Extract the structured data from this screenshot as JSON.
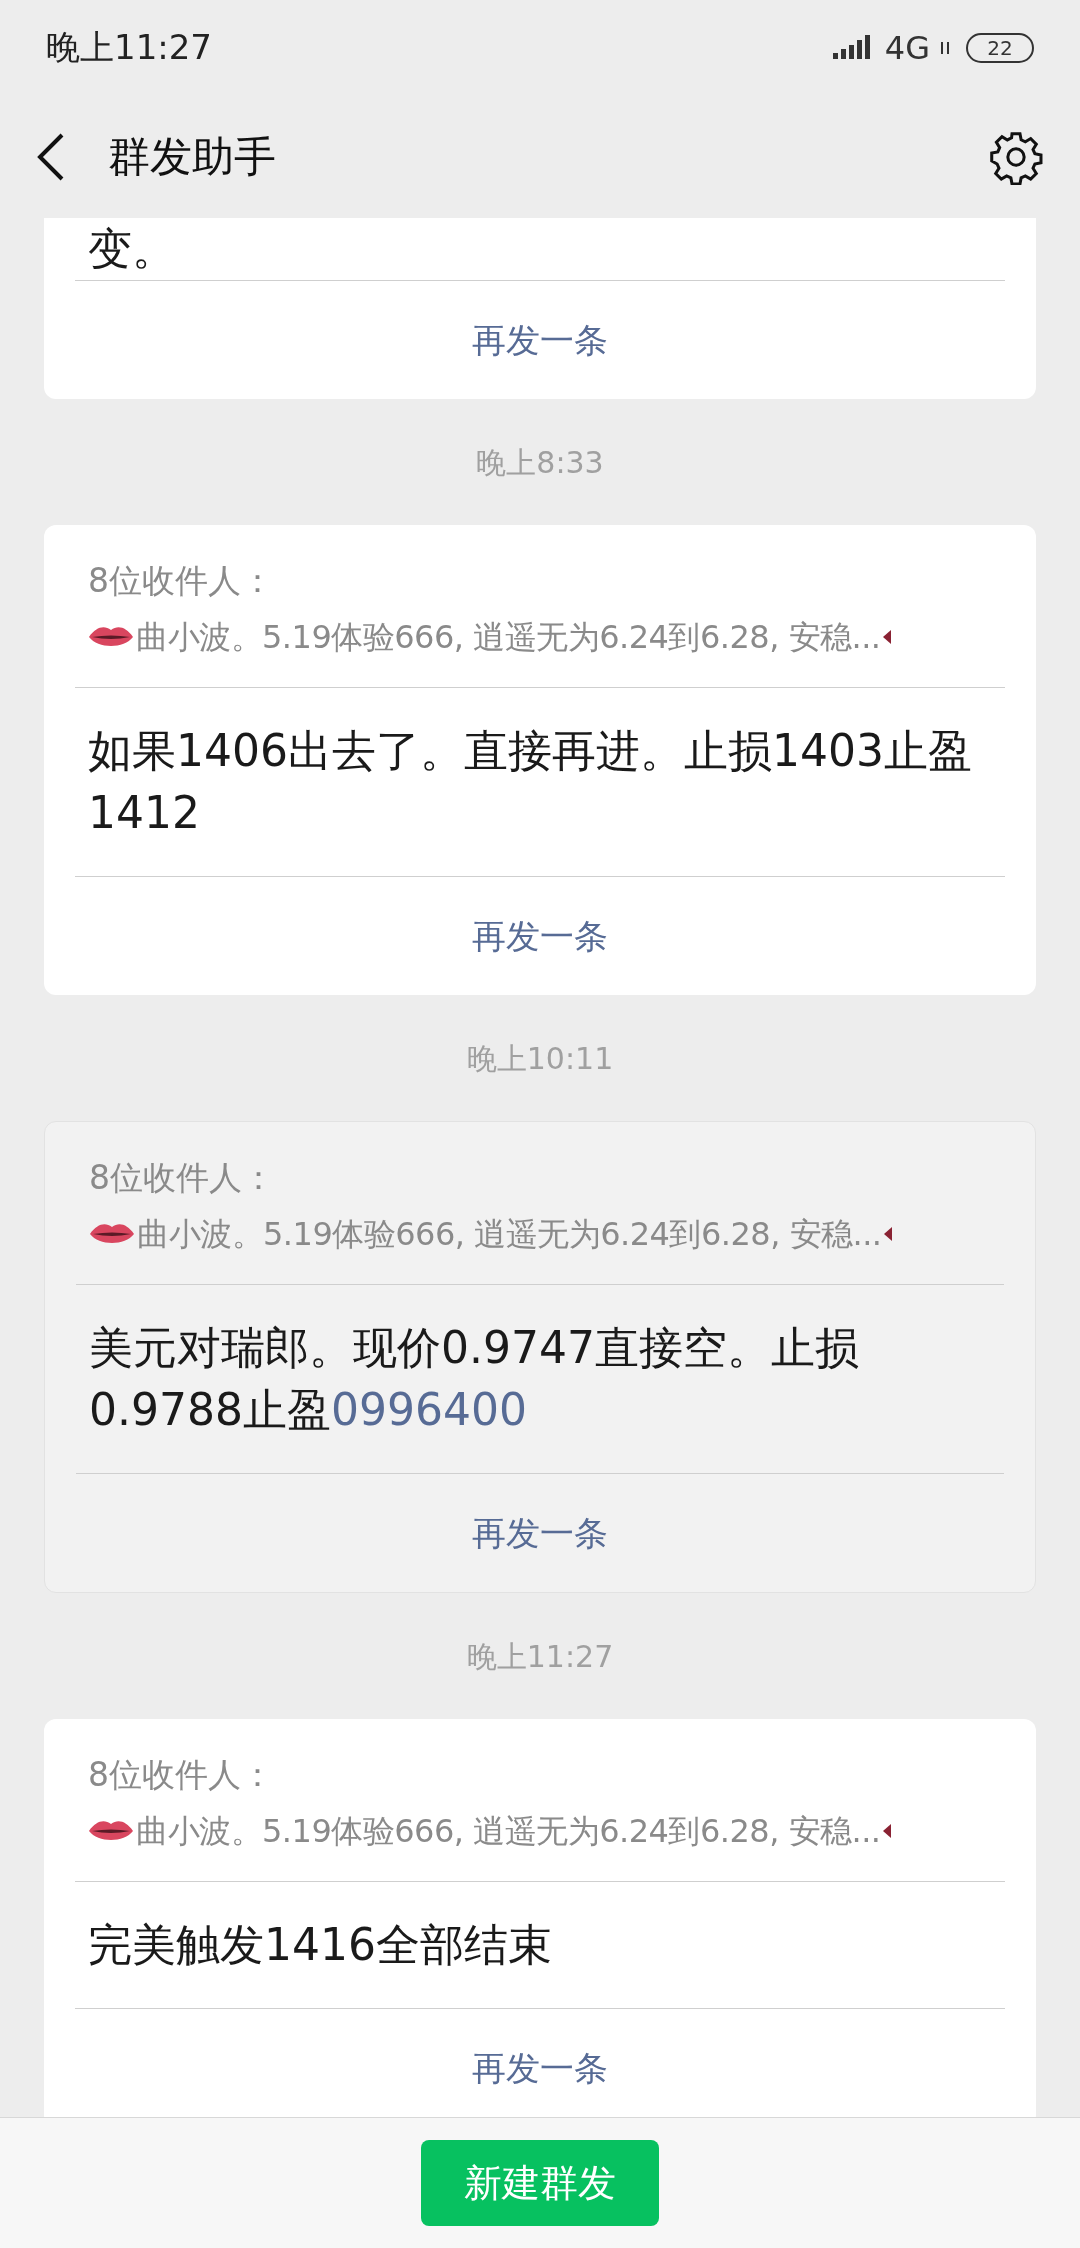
{
  "status_bar": {
    "time": "晚上11:27",
    "network": "4G",
    "battery": "22"
  },
  "header": {
    "title": "群发助手"
  },
  "messages": [
    {
      "parts": [
        {
          "kind": "text",
          "text": "变。"
        }
      ],
      "resend": "再发一条",
      "pressed": false
    },
    {
      "time": "晚上8:33",
      "recipients_label": "8位收件人：",
      "recipients": "曲小波。5.19体验666, 逍遥无为6.24到6.28, 安稳...",
      "parts": [
        {
          "kind": "text",
          "text": "如果1406出去了。直接再进。止损1403止盈1412"
        }
      ],
      "resend": "再发一条",
      "pressed": false
    },
    {
      "time": "晚上10:11",
      "recipients_label": "8位收件人：",
      "recipients": "曲小波。5.19体验666, 逍遥无为6.24到6.28, 安稳...",
      "parts": [
        {
          "kind": "text",
          "text": "美元对瑞郎。现价0.9747直接空。止损0.9788止盈"
        },
        {
          "kind": "link",
          "text": "0996400"
        }
      ],
      "resend": "再发一条",
      "pressed": true
    },
    {
      "time": "晚上11:27",
      "recipients_label": "8位收件人：",
      "recipients": "曲小波。5.19体验666, 逍遥无为6.24到6.28, 安稳...",
      "parts": [
        {
          "kind": "text",
          "text": "完美触发1416全部结束"
        }
      ],
      "resend": "再发一条",
      "pressed": false
    }
  ],
  "new_button": "新建群发"
}
